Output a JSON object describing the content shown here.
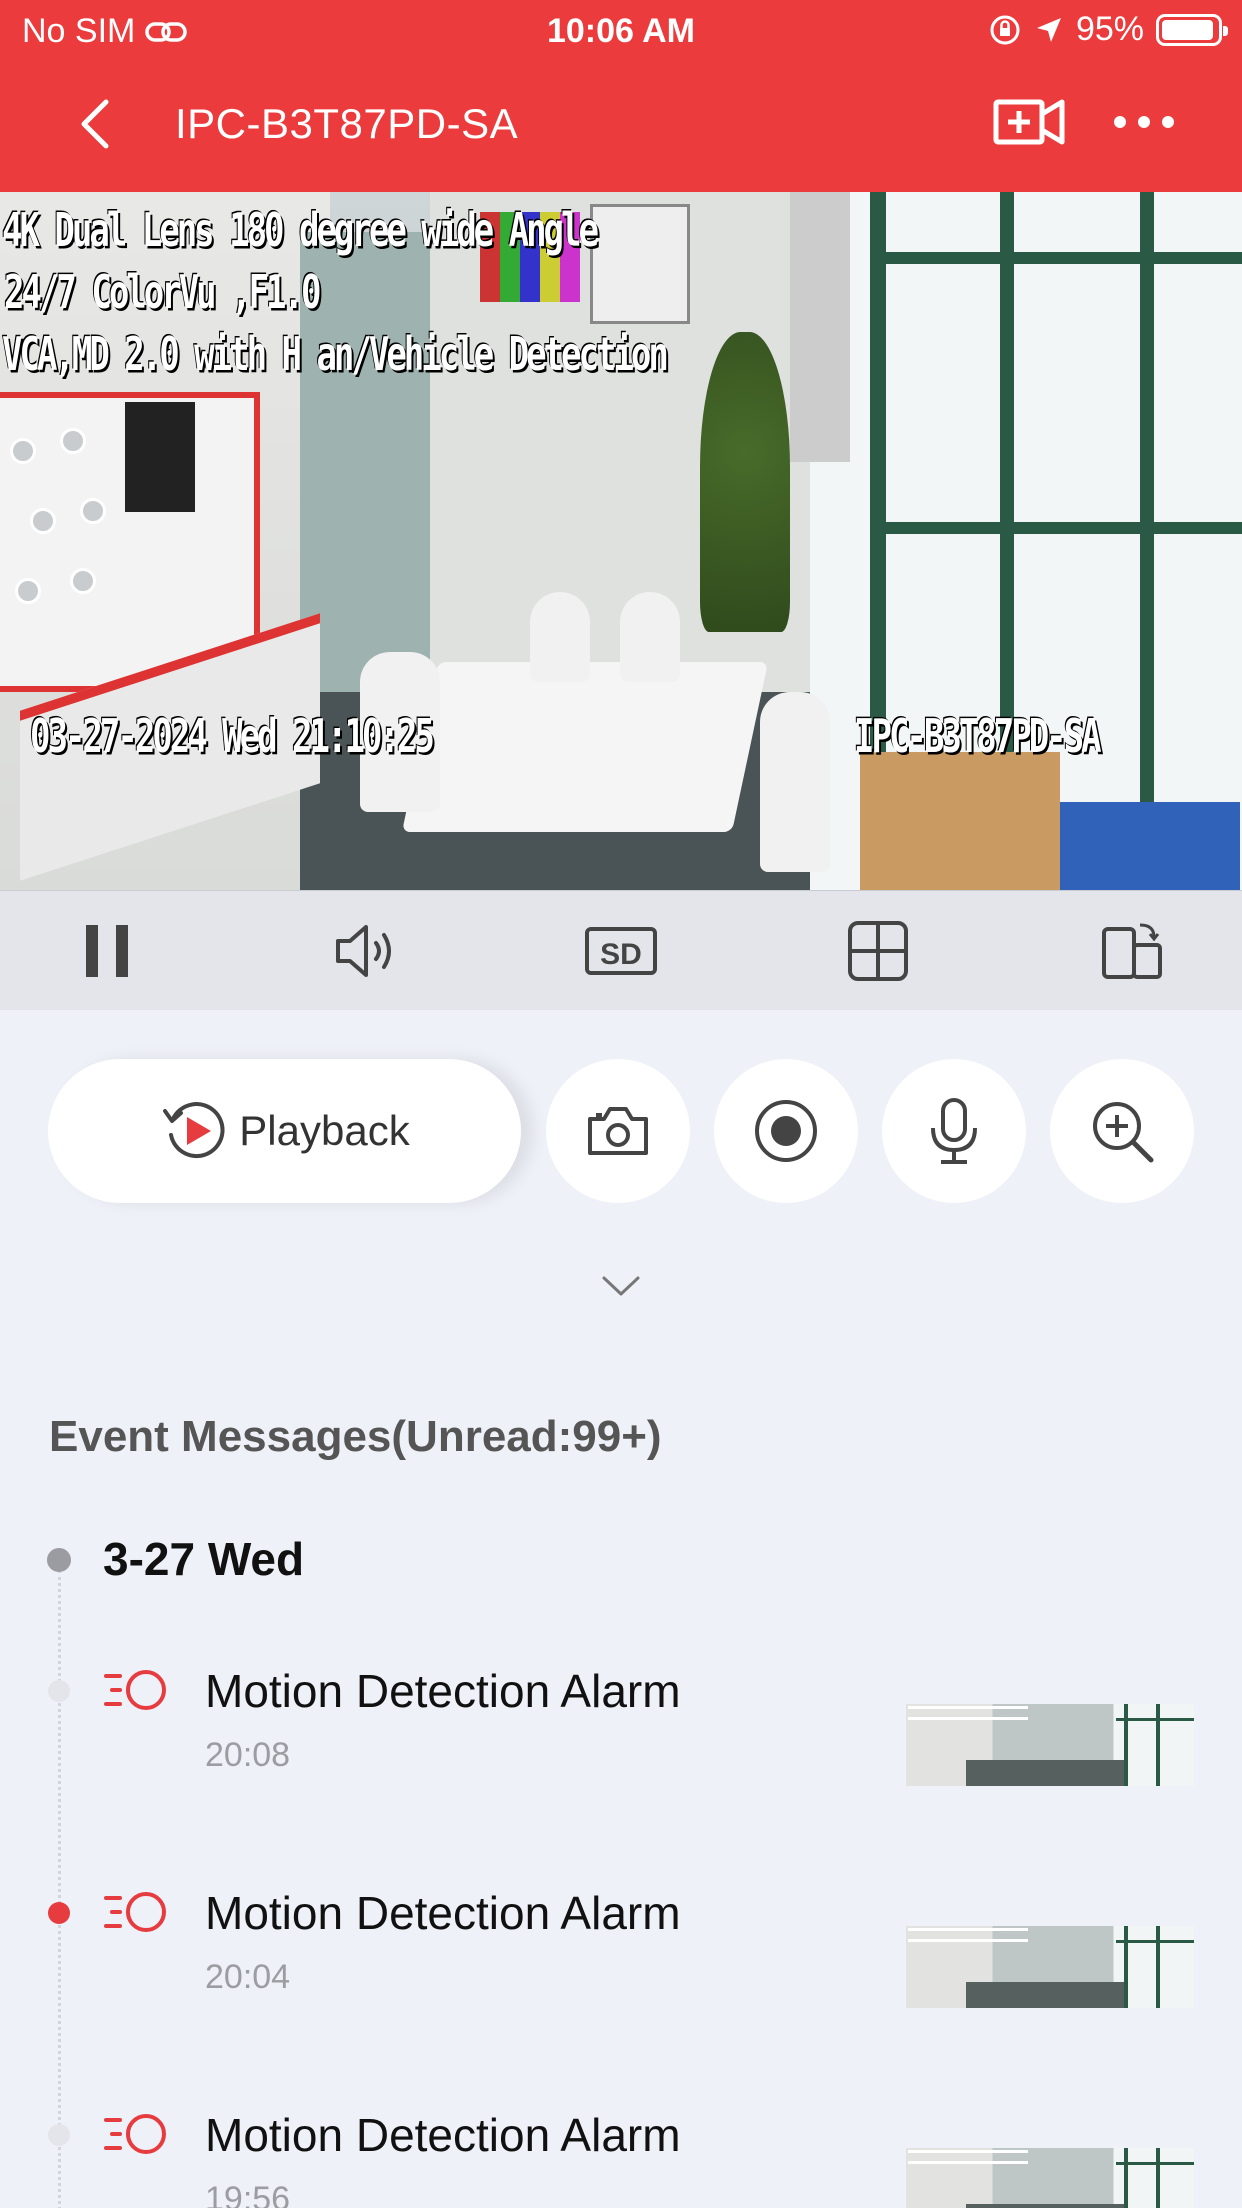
{
  "status_bar": {
    "carrier": "No SIM",
    "time": "10:06 AM",
    "battery_text": "95%",
    "battery_level": 0.95
  },
  "header": {
    "title": "IPC-B3T87PD-SA",
    "back_icon": "chevron-left-icon",
    "add_camera_icon": "video-add-icon",
    "more_icon": "more-dots-icon",
    "background": "#ec3b3d"
  },
  "video": {
    "osd_lines": [
      "4K Dual Lens 180 degree wide Angle",
      " 24/7 ColorVu ,F1.0",
      "VCA,MD 2.0 with H  an/Vehicle Detection"
    ],
    "timestamp": "03-27-2024 Wed 21:10:25",
    "camera_name": "IPC-B3T87PD-SA"
  },
  "controls": {
    "pause_icon": "pause-icon",
    "sound_icon": "speaker-icon",
    "quality_label": "SD",
    "layout_icon": "grid-icon",
    "rotate_icon": "rotate-screen-icon"
  },
  "actions": {
    "playback_label": "Playback",
    "snapshot_icon": "camera-icon",
    "record_icon": "record-icon",
    "talk_icon": "microphone-icon",
    "zoom_icon": "zoom-in-icon"
  },
  "events": {
    "title": "Event Messages(Unread:99+)",
    "date_label": "3-27 Wed",
    "accent": "#e63c3f",
    "items": [
      {
        "title": "Motion Detection Alarm",
        "time": "20:08",
        "unread": false
      },
      {
        "title": "Motion Detection Alarm",
        "time": "20:04",
        "unread": true
      },
      {
        "title": "Motion Detection Alarm",
        "time": "19:56",
        "unread": false
      }
    ]
  }
}
